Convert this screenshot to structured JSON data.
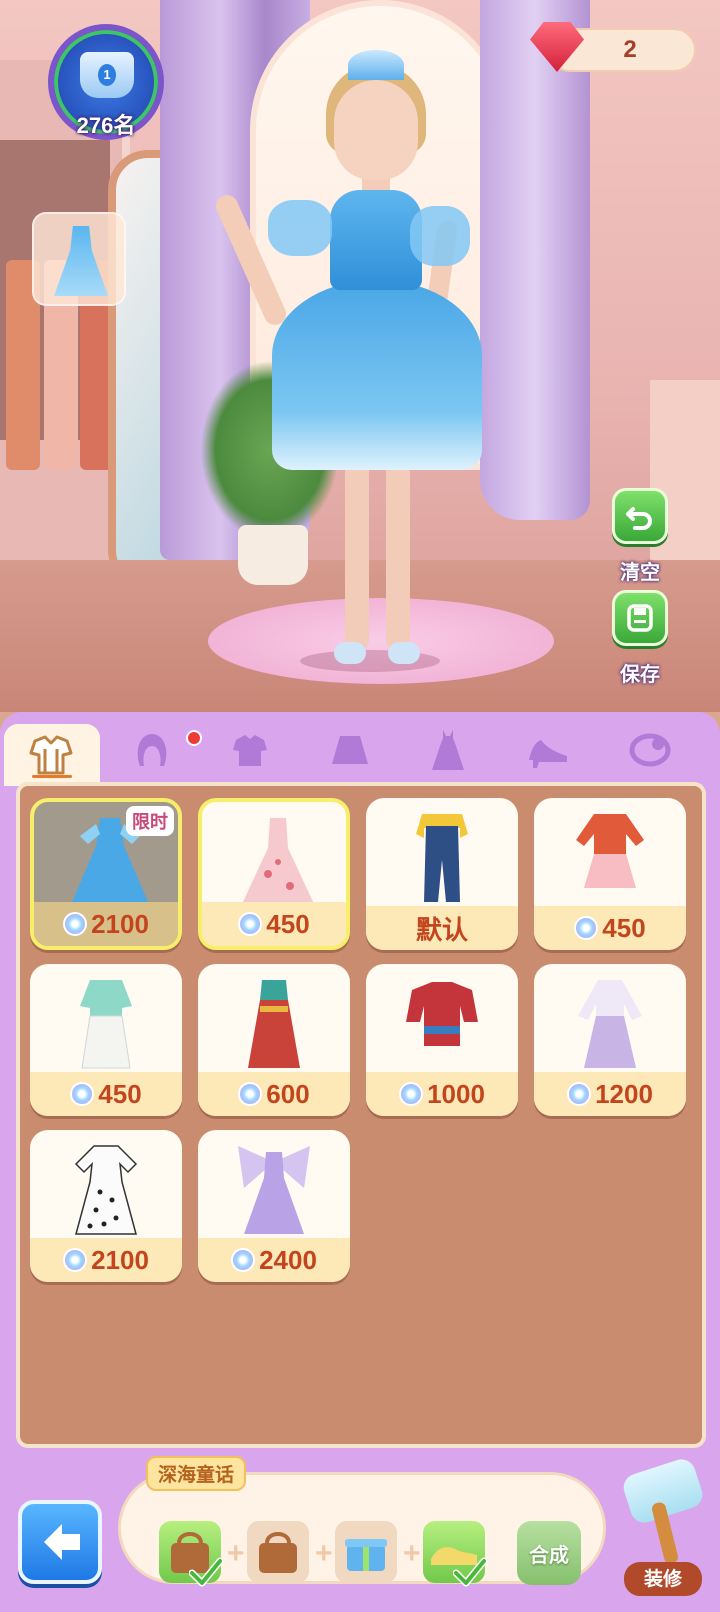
{
  "hud": {
    "rank_text": "276名",
    "rank_badge_number": "1",
    "gem_count": "2"
  },
  "side_buttons": {
    "clear_label": "清空",
    "save_label": "保存"
  },
  "tabs": [
    {
      "icon": "outfit-set-icon",
      "active": true
    },
    {
      "icon": "hair-icon",
      "active": false,
      "notify": true
    },
    {
      "icon": "top-shirt-icon",
      "active": false
    },
    {
      "icon": "skirt-icon",
      "active": false
    },
    {
      "icon": "dress-icon",
      "active": false
    },
    {
      "icon": "high-heel-icon",
      "active": false
    },
    {
      "icon": "accessory-icon",
      "active": false
    }
  ],
  "items": [
    {
      "price": "2100",
      "tag": "限时",
      "selected": true,
      "dim": true,
      "icon": "blue-fairy-dress"
    },
    {
      "price": "450",
      "selected": true,
      "icon": "pink-floral-gown"
    },
    {
      "price": "默认",
      "icon": "denim-overalls"
    },
    {
      "price": "450",
      "icon": "red-jacket-pink-skirt"
    },
    {
      "price": "450",
      "icon": "mint-qipao-outfit"
    },
    {
      "price": "600",
      "icon": "red-gold-hanfu"
    },
    {
      "price": "1000",
      "icon": "ethnic-red-costume"
    },
    {
      "price": "1200",
      "icon": "lavender-hanfu"
    },
    {
      "price": "2100",
      "icon": "polka-dot-dress"
    },
    {
      "price": "2400",
      "icon": "butterfly-wing-gown"
    }
  ],
  "combo": {
    "title": "深海童话",
    "merge_label": "合成"
  },
  "decorate_label": "装修",
  "colors": {
    "accent_orange": "#c3451d",
    "panel_purple": "#d9a6ee",
    "grid_brown": "#c98c6f",
    "green_button": "#3aa839",
    "blue_button": "#1f79e6"
  }
}
